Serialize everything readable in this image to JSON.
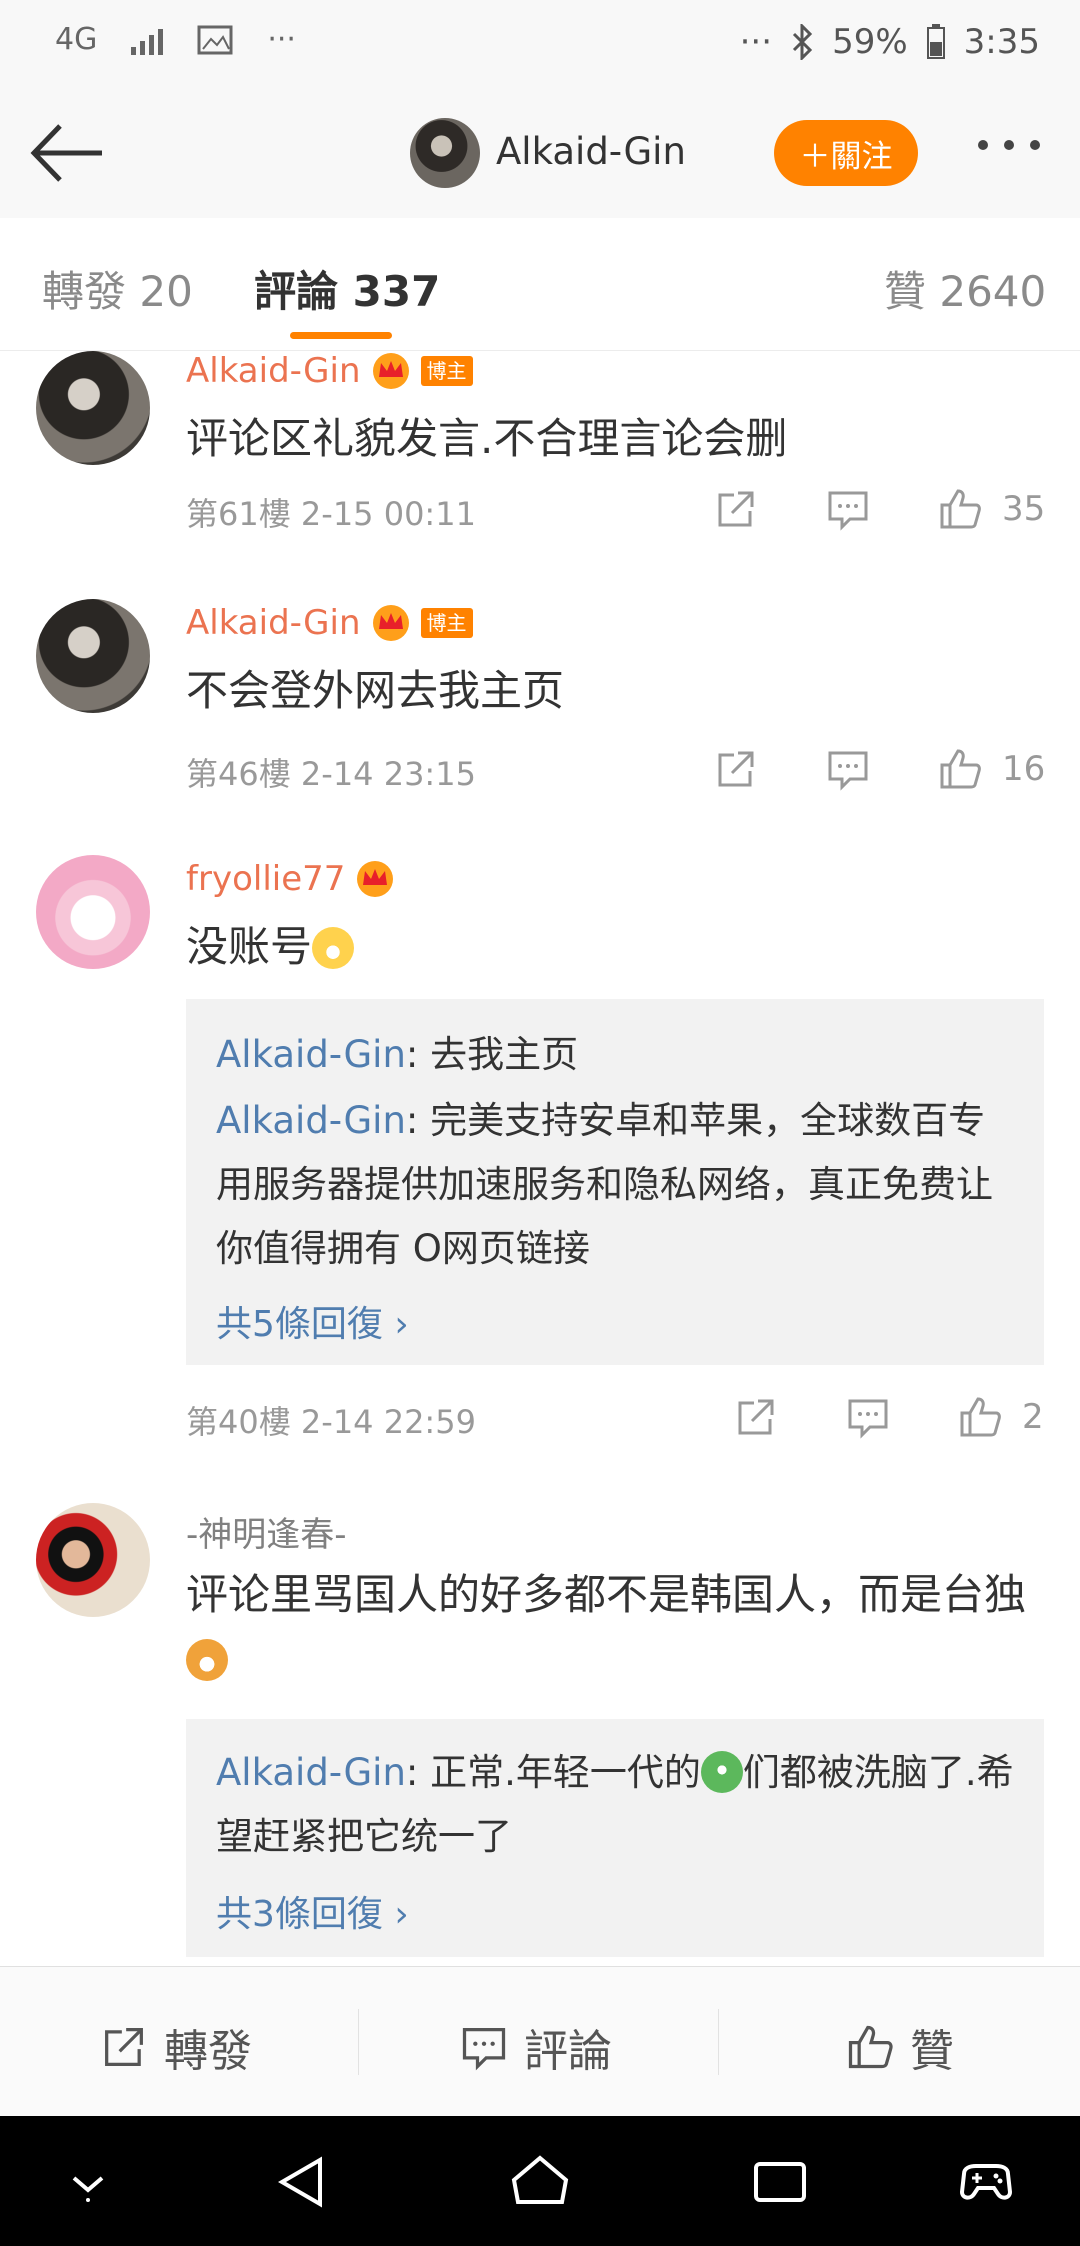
{
  "status_bar": {
    "network": "4G",
    "extra": "···",
    "extra_right": "···",
    "battery": "59%",
    "time": "3:35"
  },
  "header": {
    "user_name": "Alkaid-Gin",
    "follow_label": "＋關注"
  },
  "tabs": [
    {
      "label": "轉發 20",
      "active": false
    },
    {
      "label": "評論 337",
      "active": true
    },
    {
      "label": "贊 2640",
      "active": false
    }
  ],
  "comments": [
    {
      "user": "Alkaid-Gin",
      "is_host": true,
      "host_label": "博主",
      "text": "评论区礼貌发言.不合理言论会删",
      "floor": "第61樓",
      "time": "2-15 00:11",
      "likes": "35"
    },
    {
      "user": "Alkaid-Gin",
      "is_host": true,
      "host_label": "博主",
      "text": "不会登外网去我主页",
      "floor": "第46樓",
      "time": "2-14 23:15",
      "likes": "16"
    },
    {
      "user": "fryollie77",
      "text": "没账号",
      "replies": [
        {
          "name": "Alkaid-Gin",
          "text": ": 去我主页"
        },
        {
          "name": "Alkaid-Gin",
          "text": ": 完美支持安卓和苹果，全球数百专用服务器提供加速服务和隐私网络，真正免费让你值得拥有 O网页链接"
        }
      ],
      "more_replies": "共5條回復 ›",
      "floor": "第40樓",
      "time": "2-14 22:59",
      "likes": "2"
    },
    {
      "user": "-神明逢春-",
      "text": "评论里骂国人的好多都不是韩国人，而是台独",
      "replies": [
        {
          "name": "Alkaid-Gin",
          "text_a": ": 正常.年轻一代的",
          "text_b": "们都被洗脑了.希望赶紧把它统一了"
        }
      ],
      "more_replies": "共3條回復 ›"
    }
  ],
  "bottom_bar": {
    "repost": "轉發",
    "comment": "評論",
    "like": "贊"
  },
  "colors": {
    "accent": "#ff8200",
    "username": "#eb7350",
    "reply_name": "#507daf"
  },
  "icons": [
    "back-arrow-icon",
    "more-icon",
    "crown-icon",
    "share-icon",
    "comment-icon",
    "like-icon",
    "chevron-right-icon",
    "nav-back-icon",
    "nav-home-icon",
    "nav-recent-icon",
    "game-icon"
  ]
}
